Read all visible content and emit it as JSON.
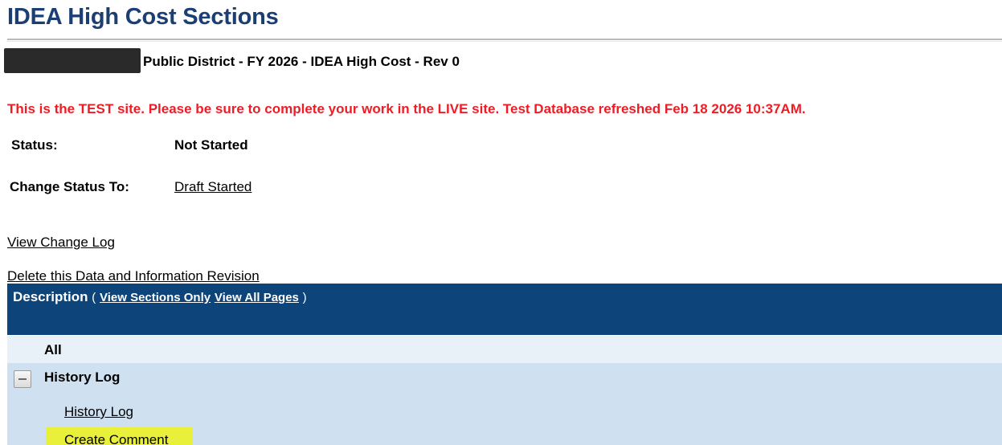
{
  "page": {
    "title": "IDEA High Cost Sections",
    "district_line": "Public District - FY 2026 - IDEA High Cost - Rev 0",
    "test_warning": "This is the TEST site. Please be sure to complete your work in the LIVE site. Test Database refreshed Feb 18 2026 10:37AM."
  },
  "status": {
    "label": "Status:",
    "value": "Not Started",
    "change_label": "Change Status To:",
    "change_link": "Draft Started"
  },
  "links": {
    "view_change_log": "View Change Log",
    "delete_revision": "Delete this Data and Information Revision"
  },
  "description_header": {
    "title": "Description",
    "open_paren": "(",
    "view_sections_only": "View Sections Only",
    "view_all_pages": "View All Pages",
    "close_paren": ")"
  },
  "sections": {
    "all_label": "All",
    "history_group_label": "History Log",
    "items": [
      {
        "label": "History Log"
      },
      {
        "label": "Create Comment"
      }
    ]
  },
  "colors": {
    "title": "#1b3f73",
    "warning": "#ee1c25",
    "header_bg": "#0d4479",
    "row_all_bg": "#e9f1f8",
    "row_group_bg": "#cfe1f1",
    "highlight": "#e8f03a"
  },
  "icons": {
    "collapse": "minus-collapse-icon"
  }
}
